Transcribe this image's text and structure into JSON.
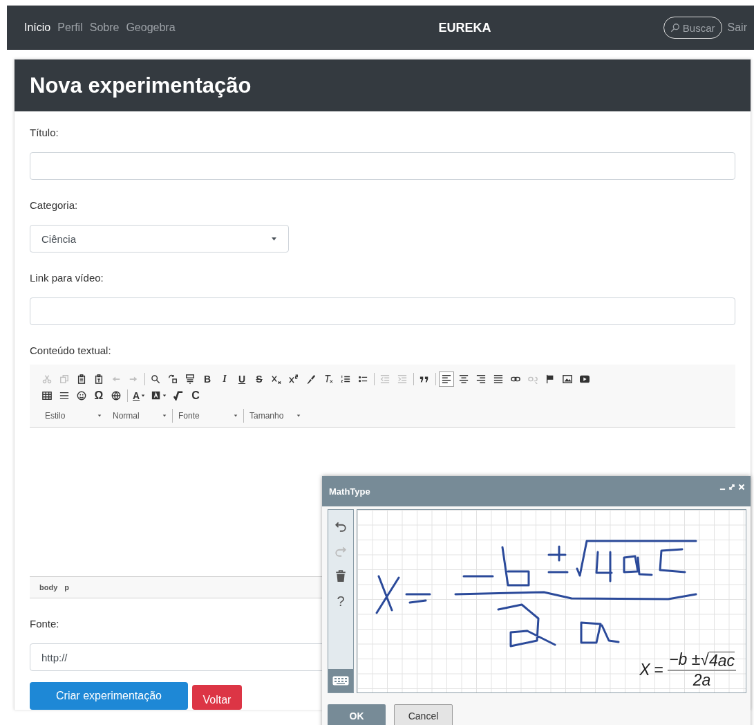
{
  "navbar": {
    "links": [
      {
        "label": "Início",
        "selected": true
      },
      {
        "label": "Perfil",
        "selected": false
      },
      {
        "label": "Sobre",
        "selected": false
      },
      {
        "label": "Geogebra",
        "selected": false
      }
    ],
    "brand": "EUREKA",
    "search_button": "Buscar",
    "logout": "Sair"
  },
  "card": {
    "title": "Nova experimentação",
    "fields": [
      {
        "kind": "input",
        "label": "Título:"
      },
      {
        "kind": "select",
        "label": "Categoria:",
        "value": "Ciência"
      },
      {
        "kind": "input",
        "label": "Link para vídeo:"
      }
    ],
    "editor": {
      "label": "Conteúdo textual:",
      "toolbar_rows": [
        [
          {
            "kind": "cut",
            "disabled": true,
            "selected": false
          },
          {
            "kind": "copy",
            "disabled": true,
            "selected": false
          },
          {
            "kind": "paste",
            "disabled": false,
            "selected": false
          },
          {
            "kind": "pastetext",
            "disabled": false,
            "selected": false
          },
          {
            "kind": "undo",
            "disabled": true,
            "selected": false
          },
          {
            "kind": "redo",
            "disabled": true,
            "selected": false
          },
          {
            "kind": "separator"
          },
          {
            "kind": "find",
            "disabled": false,
            "selected": false
          },
          {
            "kind": "replace",
            "disabled": false,
            "selected": false
          },
          {
            "kind": "selectall",
            "disabled": false,
            "selected": false
          },
          {
            "kind": "bold",
            "text": "B",
            "disabled": false,
            "selected": false
          },
          {
            "kind": "italic",
            "text": "I",
            "disabled": false,
            "selected": false
          },
          {
            "kind": "underline",
            "text": "U",
            "disabled": false,
            "selected": false
          },
          {
            "kind": "strike",
            "text": "S",
            "disabled": false,
            "selected": false
          },
          {
            "kind": "subscript",
            "disabled": false,
            "selected": false
          },
          {
            "kind": "superscript",
            "disabled": false,
            "selected": false
          },
          {
            "kind": "brush",
            "disabled": false,
            "selected": false
          },
          {
            "kind": "removeformat",
            "disabled": false,
            "selected": false
          },
          {
            "kind": "numbered",
            "disabled": false,
            "selected": false
          },
          {
            "kind": "bulleted",
            "disabled": false,
            "selected": false
          },
          {
            "kind": "separator"
          },
          {
            "kind": "outdent",
            "disabled": true,
            "selected": false
          },
          {
            "kind": "indent",
            "disabled": true,
            "selected": false
          },
          {
            "kind": "separator"
          },
          {
            "kind": "quote",
            "disabled": false,
            "selected": false
          },
          {
            "kind": "separator"
          },
          {
            "kind": "alignleft",
            "disabled": false,
            "selected": true
          },
          {
            "kind": "aligncenter",
            "disabled": false,
            "selected": false
          },
          {
            "kind": "alignright",
            "disabled": false,
            "selected": false
          },
          {
            "kind": "justify",
            "disabled": false,
            "selected": false
          },
          {
            "kind": "link",
            "disabled": false,
            "selected": false
          },
          {
            "kind": "unlink",
            "disabled": true,
            "selected": false
          },
          {
            "kind": "flag",
            "disabled": false,
            "selected": false
          },
          {
            "kind": "image",
            "disabled": false,
            "selected": false
          },
          {
            "kind": "video",
            "disabled": false,
            "selected": false
          }
        ],
        [
          {
            "kind": "table",
            "disabled": false,
            "selected": false
          },
          {
            "kind": "rule",
            "disabled": false,
            "selected": false
          },
          {
            "kind": "smiley",
            "disabled": false,
            "selected": false
          },
          {
            "kind": "symbol",
            "text": "Ω",
            "disabled": false,
            "selected": false
          },
          {
            "kind": "globe",
            "disabled": false,
            "selected": false
          },
          {
            "kind": "separator"
          },
          {
            "kind": "textcolor",
            "text": "A",
            "disabled": false,
            "selected": false
          },
          {
            "kind": "bgcolor",
            "disabled": false,
            "selected": false
          },
          {
            "kind": "sqrt",
            "disabled": false,
            "selected": false
          },
          {
            "kind": "chem",
            "text": "C",
            "disabled": false,
            "selected": false
          }
        ]
      ],
      "dropdowns": [
        "Estilo",
        "Normal",
        "Fonte",
        "Tamanho"
      ],
      "path": [
        "body",
        "p"
      ]
    },
    "source": {
      "label": "Fonte:",
      "value": "http://"
    },
    "buttons": [
      {
        "kind": "primary",
        "label": "Criar experimentação"
      },
      {
        "kind": "danger",
        "label": "Voltar"
      }
    ]
  },
  "mathtype": {
    "title": "MathType",
    "tools": [
      {
        "kind": "undo",
        "disabled": false
      },
      {
        "kind": "redo",
        "disabled": true
      },
      {
        "kind": "trash",
        "disabled": false
      },
      {
        "kind": "help",
        "text": "?",
        "disabled": false
      }
    ],
    "formula": {
      "lhs": "X",
      "equals": "=",
      "numerator": "−b ±",
      "radical": "√",
      "radicand": "4ac",
      "denominator": "2a"
    },
    "buttons": [
      {
        "kind": "primary",
        "label": "OK"
      },
      {
        "kind": "secondary",
        "label": "Cancel"
      }
    ]
  }
}
